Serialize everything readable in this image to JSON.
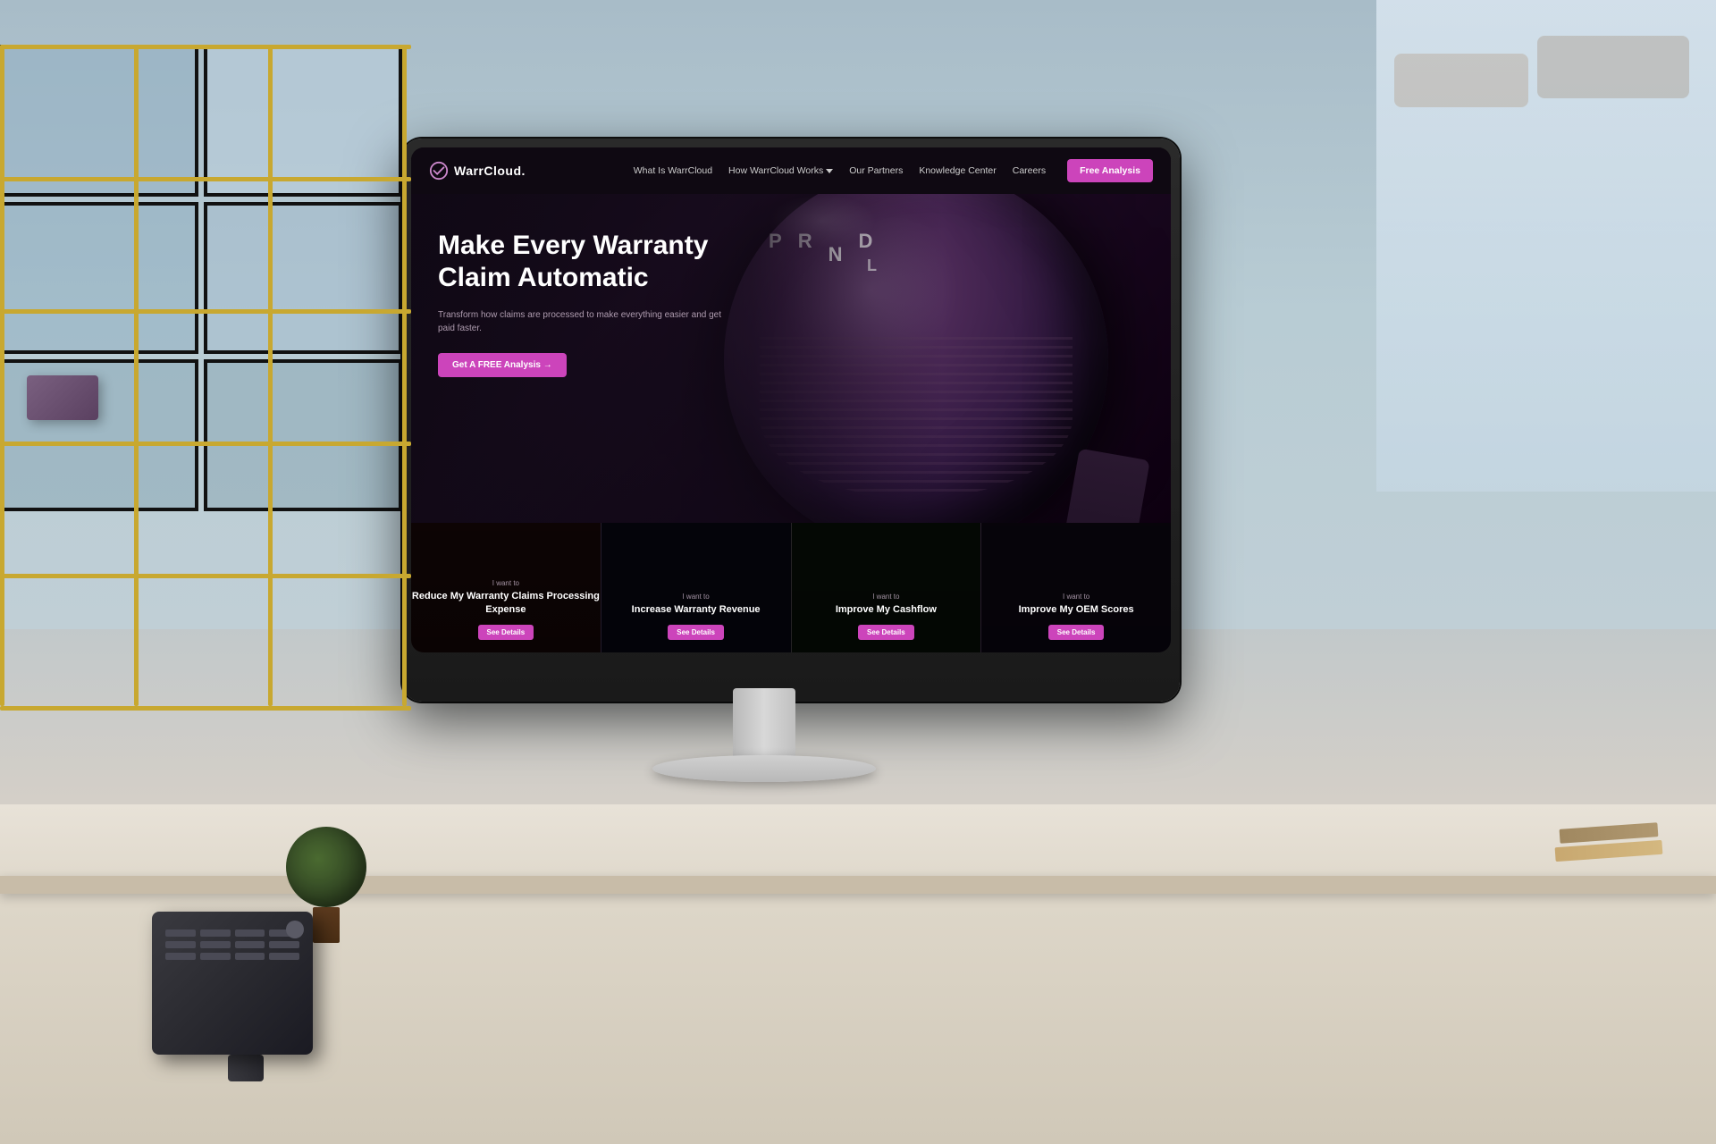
{
  "room": {
    "background_color": "#b8c5cc"
  },
  "website": {
    "nav": {
      "logo_text": "WarrCloud.",
      "links": [
        {
          "label": "What Is WarrCloud",
          "has_dropdown": false
        },
        {
          "label": "How WarrCloud Works",
          "has_dropdown": true
        },
        {
          "label": "Our Partners",
          "has_dropdown": false
        },
        {
          "label": "Knowledge Center",
          "has_dropdown": false
        },
        {
          "label": "Careers",
          "has_dropdown": false
        }
      ],
      "cta_label": "Free Analysis"
    },
    "hero": {
      "title": "Make Every Warranty Claim Automatic",
      "subtitle": "Transform how claims are processed to make everything easier and get paid faster.",
      "cta_label": "Get A FREE Analysis →",
      "gear_labels": [
        "P",
        "R",
        "N",
        "D",
        "L"
      ]
    },
    "cards": [
      {
        "prefix": "I want to",
        "title": "Reduce My Warranty Claims Processing Expense",
        "btn_label": "See Details"
      },
      {
        "prefix": "I want to",
        "title": "Increase Warranty Revenue",
        "btn_label": "See Details"
      },
      {
        "prefix": "I want to",
        "title": "Improve My Cashflow",
        "btn_label": "See Details"
      },
      {
        "prefix": "I want to",
        "title": "Improve My OEM Scores",
        "btn_label": "See Details"
      }
    ]
  },
  "colors": {
    "accent": "#cc44bb",
    "nav_bg": "#0f0a12",
    "hero_bg": "#1a0e1e",
    "card_btn": "#cc44bb",
    "logo_accent": "#cc88cc",
    "shelf_gold": "#c8a830",
    "text_white": "#ffffff",
    "text_muted": "rgba(200,180,200,0.85)"
  }
}
